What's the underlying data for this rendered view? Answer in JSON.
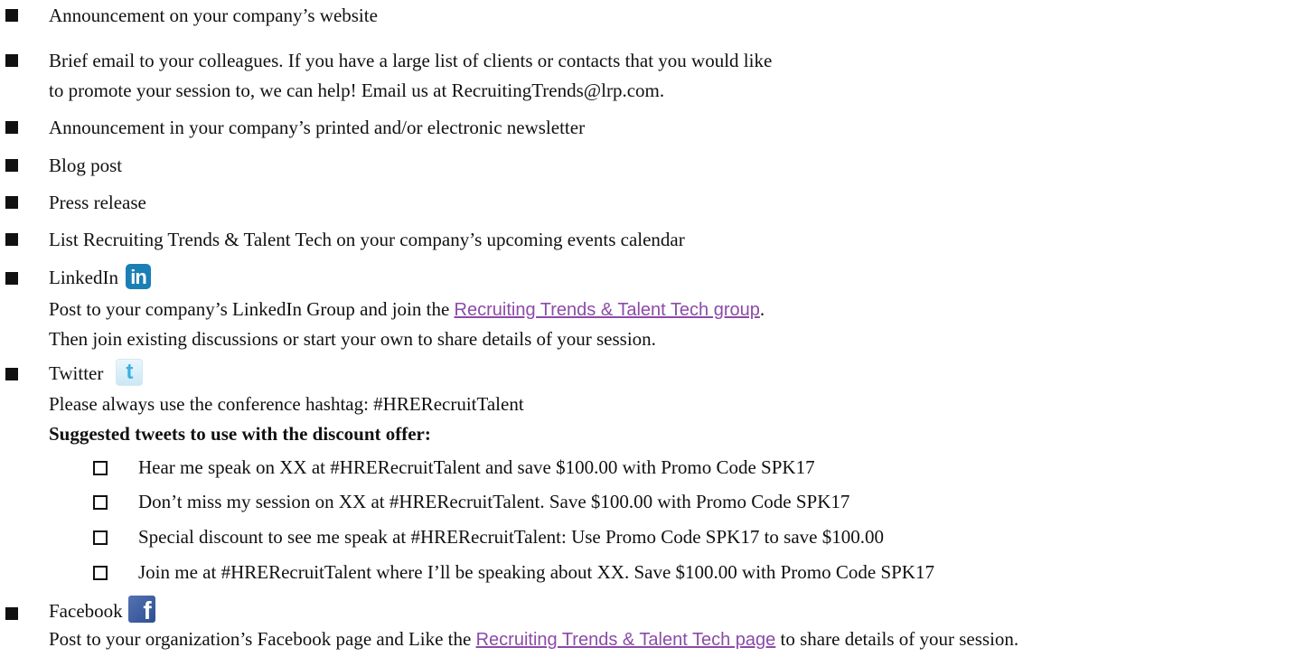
{
  "items": [
    {
      "text": "Announcement on your company’s website"
    },
    {
      "line1": "Brief email to your colleagues.  If you have a large list of clients or contacts that you would like",
      "line2": "to promote your session to, we can help! Email us at RecruitingTrends@lrp.com."
    },
    {
      "text": "Announcement in your company’s printed and/or electronic newsletter"
    },
    {
      "text": "Blog post"
    },
    {
      "text": "Press release"
    },
    {
      "text": "List Recruiting Trends & Talent Tech on your company’s upcoming events calendar"
    }
  ],
  "linkedin": {
    "label": "LinkedIn",
    "logo_text": "in",
    "line1_pre": "Post to your company’s LinkedIn Group and join the ",
    "line1_link": "Recruiting Trends & Talent Tech group",
    "line1_post": ".",
    "line2": "Then join existing discussions or start your own to share details of your session."
  },
  "twitter": {
    "label": "Twitter",
    "logo_text": "t",
    "hashtag_line": "Please always use the conference hashtag: #HRERecruitTalent",
    "tweets_heading": "Suggested tweets to use with the discount offer:",
    "tweets": [
      "Hear me speak on XX at #HRERecruitTalent and save $100.00 with Promo Code SPK17",
      "Don’t miss my session on XX at #HRERecruitTalent. Save $100.00 with Promo Code SPK17",
      "Special discount to see me speak at #HRERecruitTalent: Use Promo Code SPK17 to save $100.00",
      "Join me at #HRERecruitTalent where I’ll be speaking about XX. Save $100.00 with Promo Code SPK17"
    ]
  },
  "facebook": {
    "label": "Facebook",
    "logo_text": "f",
    "line_pre": "Post to your organization’s Facebook page and Like the ",
    "line_link": "Recruiting Trends & Talent Tech page",
    "line_post": " to share details of your session."
  },
  "colors": {
    "link": "#8b4ba8",
    "linkedin": "#1a7fb5",
    "twitter": "#3cb0e0",
    "facebook": "#3b5998"
  }
}
